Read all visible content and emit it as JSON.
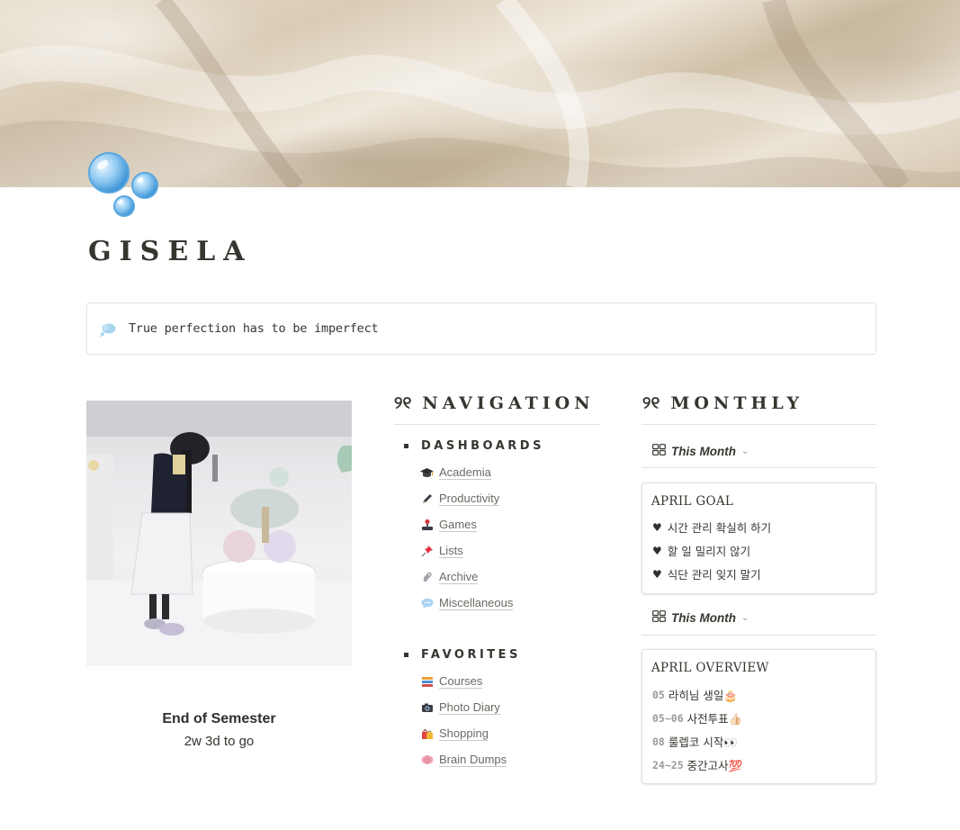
{
  "page": {
    "title": "GISELA",
    "icon": "bubbles-icon"
  },
  "callout": {
    "icon": "thought-balloon-icon",
    "text": "True perfection has to be imperfect"
  },
  "countdown": {
    "title": "End of Semester",
    "subtitle": "2w 3d to go"
  },
  "navigation": {
    "heading_glyph": "୨୧",
    "heading": "NAVIGATION",
    "groups": [
      {
        "label": "DASHBOARDS",
        "items": [
          {
            "icon": "graduation-cap-icon",
            "label": "Academia"
          },
          {
            "icon": "pen-icon",
            "label": "Productivity"
          },
          {
            "icon": "joystick-icon",
            "label": "Games"
          },
          {
            "icon": "pushpin-icon",
            "label": "Lists"
          },
          {
            "icon": "paperclip-icon",
            "label": "Archive"
          },
          {
            "icon": "speech-balloon-icon",
            "label": "Miscellaneous"
          }
        ]
      },
      {
        "label": "FAVORITES",
        "items": [
          {
            "icon": "books-icon",
            "label": "Courses"
          },
          {
            "icon": "camera-icon",
            "label": "Photo Diary"
          },
          {
            "icon": "shopping-bags-icon",
            "label": "Shopping"
          },
          {
            "icon": "brain-icon",
            "label": "Brain Dumps"
          }
        ]
      }
    ]
  },
  "monthly": {
    "heading_glyph": "୨୧",
    "heading": "MONTHLY",
    "views": [
      {
        "label": "This Month"
      },
      {
        "label": "This Month"
      }
    ],
    "goal_card": {
      "title": "APRIL GOAL",
      "lines": [
        "시간 관리 확실히 하기",
        "할 일 밀리지 않기",
        "식단 관리 잊지 말기"
      ]
    },
    "overview_card": {
      "title": "APRIL OVERVIEW",
      "lines": [
        {
          "date": "05",
          "text": "라히님 생일🎂"
        },
        {
          "date": "05~06",
          "text": "사전투표👍🏻"
        },
        {
          "date": "08",
          "text": "룰렙코 시작👀"
        },
        {
          "date": "24~25",
          "text": "중간고사💯"
        }
      ]
    }
  },
  "colors": {
    "text": "#37352f",
    "muted": "#9b9a97",
    "border": "#e3e2df",
    "link": "#6b6963"
  }
}
